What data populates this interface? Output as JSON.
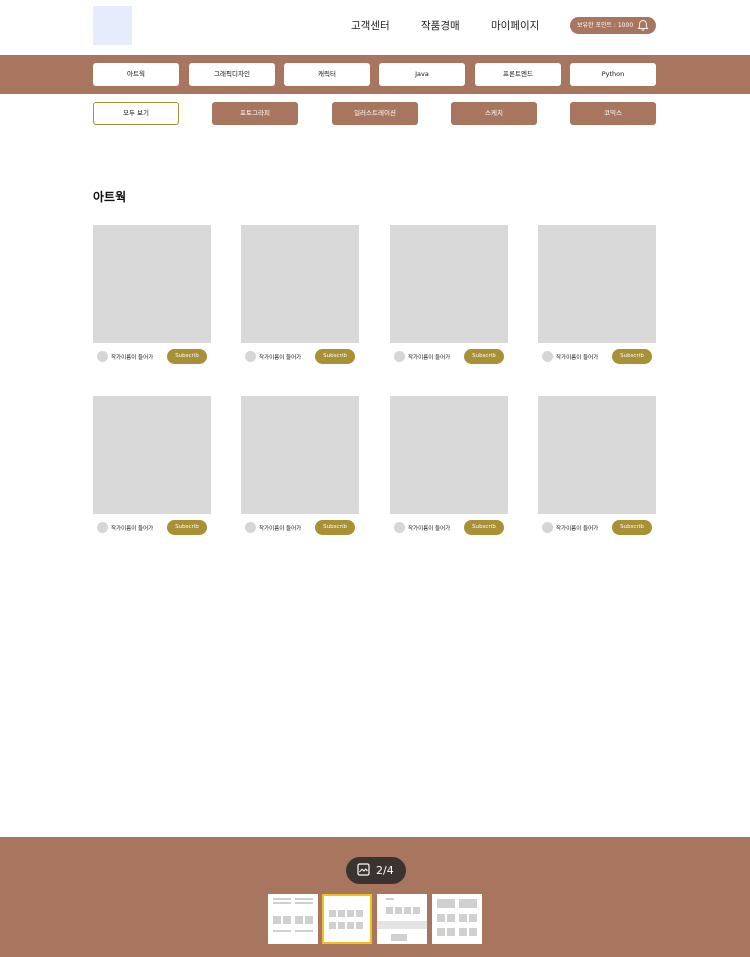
{
  "header": {
    "nav": [
      "고객센터",
      "작품경매",
      "마이페이지"
    ],
    "points_label": "보유한 포인트 : 1000"
  },
  "categories": [
    "아트웍",
    "그래픽디자인",
    "캐릭터",
    "Java",
    "프론트엔드",
    "Python"
  ],
  "subcategories": [
    "모두 보기",
    "포토그라피",
    "일러스트레이션",
    "스케치",
    "코믹스"
  ],
  "section": {
    "title": "아트웍"
  },
  "cards": [
    {
      "author": "작가이름이 들어가",
      "button": "Subscrib"
    },
    {
      "author": "작가이름이 들어가",
      "button": "Subscrib"
    },
    {
      "author": "작가이름이 들어가",
      "button": "Subscrib"
    },
    {
      "author": "작가이름이 들어가",
      "button": "Subscrib"
    },
    {
      "author": "작가이름이 들어가",
      "button": "Subscrib"
    },
    {
      "author": "작가이름이 들어가",
      "button": "Subscrib"
    },
    {
      "author": "작가이름이 들어가",
      "button": "Subscrib"
    },
    {
      "author": "작가이름이 들어가",
      "button": "Subscrib"
    }
  ],
  "pager": {
    "label": "2/4",
    "current": 2,
    "total": 4
  },
  "colors": {
    "brand": "#a8765f",
    "accent": "#a89037",
    "placeholder": "#d9d9d9",
    "selected": "#f2c21b"
  },
  "icons": {
    "bell": "bell-icon",
    "gallery": "gallery-icon"
  }
}
